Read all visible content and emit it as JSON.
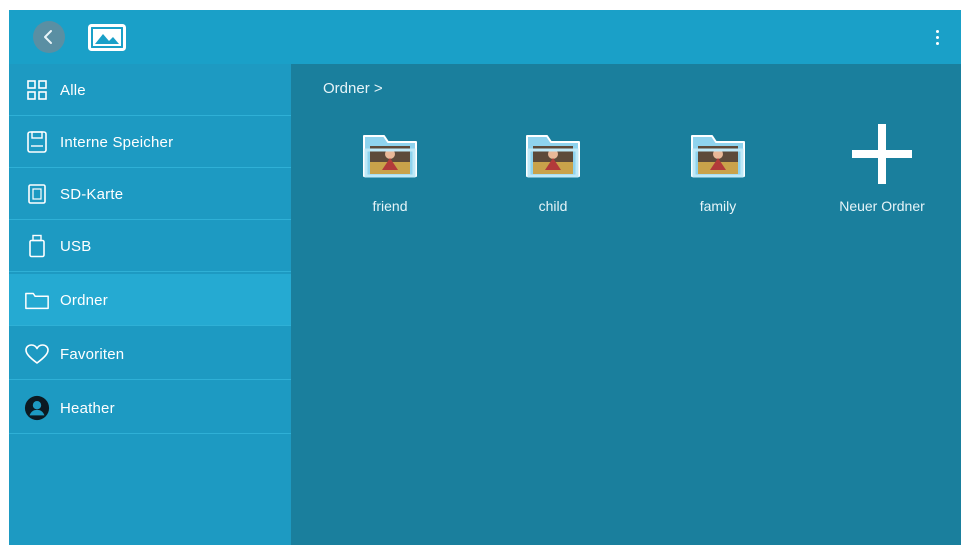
{
  "topbar": {
    "back_icon": "chevron-left-icon",
    "gallery_icon": "image-icon",
    "menu_icon": "more-vertical-icon"
  },
  "sidebar": {
    "items": [
      {
        "label": "Alle",
        "icon": "grid-icon",
        "active": false
      },
      {
        "label": "Interne Speicher",
        "icon": "internal-storage-icon",
        "active": false
      },
      {
        "label": "SD-Karte",
        "icon": "sd-card-icon",
        "active": false
      },
      {
        "label": "USB",
        "icon": "usb-icon",
        "active": false
      },
      {
        "label": "Ordner",
        "icon": "folder-icon",
        "active": true
      },
      {
        "label": "Favoriten",
        "icon": "heart-icon",
        "active": false
      },
      {
        "label": "Heather",
        "icon": "user-avatar-icon",
        "active": false
      }
    ]
  },
  "content": {
    "breadcrumb": "Ordner >",
    "folders": [
      {
        "label": "friend"
      },
      {
        "label": "child"
      },
      {
        "label": "family"
      }
    ],
    "new_folder": {
      "label": "Neuer Ordner",
      "icon": "plus-icon"
    }
  },
  "colors": {
    "topbar": "#1aa0c8",
    "sidebar": "#1d9ac2",
    "sidebar_active": "#25aad2",
    "content": "#1a7f9d"
  }
}
